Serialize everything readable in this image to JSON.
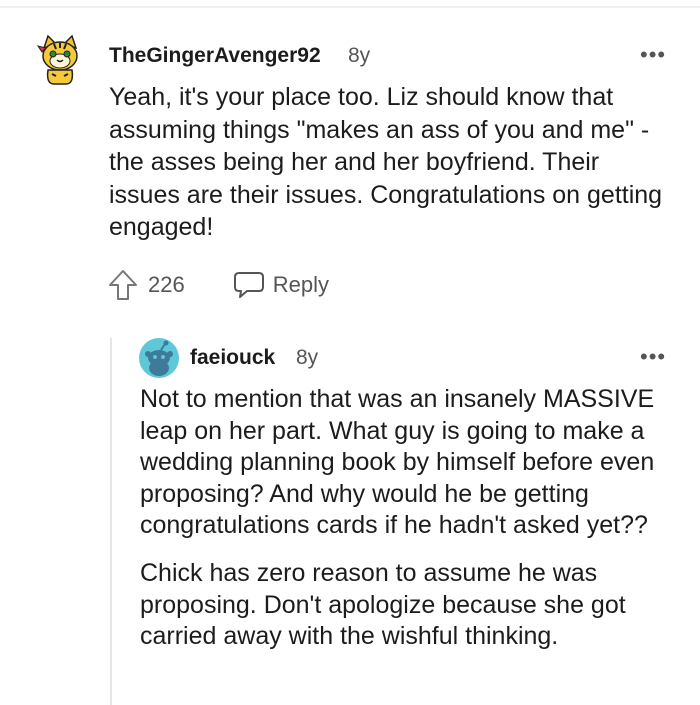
{
  "comments": [
    {
      "username": "TheGingerAvenger92",
      "age": "8y",
      "paragraphs": [
        "Yeah, it's your place too. Liz should know that assuming things \"makes an ass of you and me\" - the asses being her and her boyfriend. Their issues are their issues. Congratulations on getting engaged!"
      ],
      "upvotes": "226",
      "reply_label": "Reply"
    },
    {
      "username": "faeiouck",
      "age": "8y",
      "paragraphs": [
        "Not to mention that was an insanely MASSIVE leap on her part. What guy is going to make a wedding planning book by himself before even proposing? And why would he be getting congratulations cards if he hadn't asked yet??",
        "Chick has zero reason to assume he was proposing. Don't apologize because she got carried away with the wishful thinking."
      ]
    }
  ],
  "icons": {
    "more": "more-options-icon",
    "upvote": "upvote-arrow-icon",
    "reply": "reply-bubble-icon"
  },
  "colors": {
    "text": "#1c1c1c",
    "meta": "#555555",
    "reply_avatar_bg": "#5ec8d8",
    "thread_line": "#e6e6e6"
  }
}
